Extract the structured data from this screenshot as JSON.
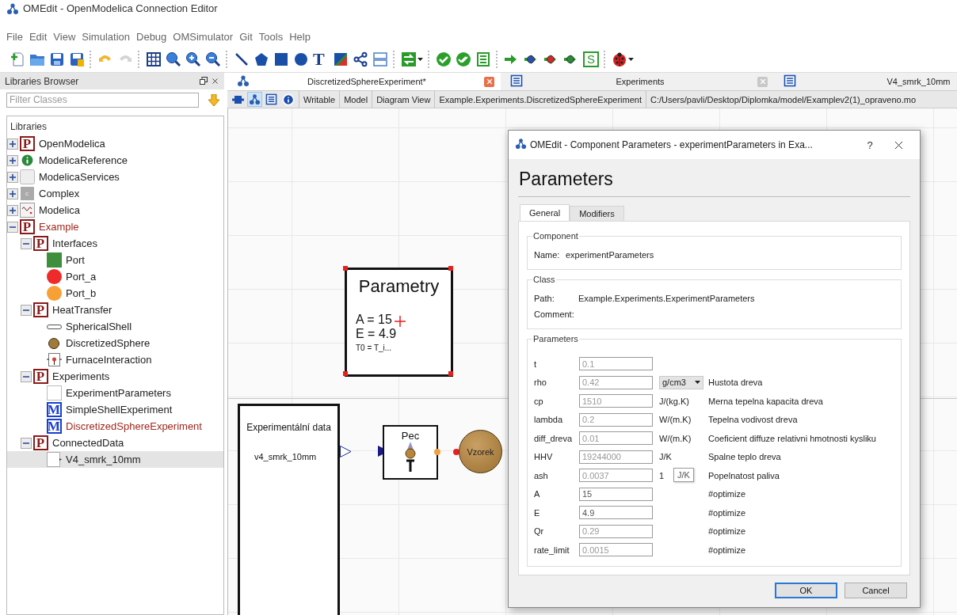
{
  "window": {
    "title": "OMEdit - OpenModelica Connection Editor"
  },
  "menu": [
    "File",
    "Edit",
    "View",
    "Simulation",
    "Debug",
    "OMSimulator",
    "Git",
    "Tools",
    "Help"
  ],
  "toolbar": [
    [
      {
        "kind": "new"
      },
      {
        "kind": "open"
      },
      {
        "kind": "save"
      },
      {
        "kind": "save-all"
      }
    ],
    [
      {
        "kind": "undo"
      },
      {
        "kind": "redo"
      }
    ],
    [
      {
        "kind": "grid"
      },
      {
        "kind": "zoom-reset"
      },
      {
        "kind": "zoom-in"
      },
      {
        "kind": "zoom-out"
      }
    ],
    [
      {
        "kind": "line"
      },
      {
        "kind": "polygon"
      },
      {
        "kind": "rectangle"
      },
      {
        "kind": "ellipse"
      },
      {
        "kind": "text-tool",
        "glyph": "T"
      },
      {
        "kind": "bitmap"
      },
      {
        "kind": "connect"
      },
      {
        "kind": "transition"
      }
    ],
    [
      {
        "kind": "swap"
      }
    ],
    [
      {
        "kind": "check"
      },
      {
        "kind": "check-all"
      },
      {
        "kind": "instantiate"
      }
    ],
    [
      {
        "kind": "simulate"
      },
      {
        "kind": "simulate-blue"
      },
      {
        "kind": "simulate-red"
      },
      {
        "kind": "simulate-green"
      },
      {
        "kind": "sim-setup",
        "glyph": "S"
      }
    ],
    [
      {
        "kind": "debugger"
      }
    ]
  ],
  "sidebar": {
    "title": "Libraries Browser",
    "filter": {
      "placeholder": "Filter Classes"
    },
    "root": "Libraries",
    "items": [
      {
        "label": "OpenModelica",
        "kind": "package",
        "badge": "P",
        "expanded": false,
        "modified": false,
        "selected": false
      },
      {
        "label": "ModelicaReference",
        "kind": "info",
        "expanded": false,
        "modified": false,
        "selected": false
      },
      {
        "label": "ModelicaServices",
        "kind": "blank",
        "expanded": false,
        "modified": false,
        "selected": false
      },
      {
        "label": "Complex",
        "kind": "complex",
        "badge": "c",
        "expanded": false,
        "modified": false,
        "selected": false
      },
      {
        "label": "Modelica",
        "kind": "modelica",
        "expanded": false,
        "modified": false,
        "selected": false
      },
      {
        "label": "Example",
        "kind": "package",
        "badge": "P",
        "expanded": true,
        "modified": true,
        "selected": false,
        "children": [
          {
            "label": "Interfaces",
            "kind": "package",
            "badge": "P",
            "expanded": true,
            "modified": false,
            "selected": false,
            "children": [
              {
                "label": "Port",
                "kind": "port-square",
                "color": "#3d8f3d",
                "modified": false,
                "selected": false
              },
              {
                "label": "Port_a",
                "kind": "port-circle",
                "color": "#ee2a2a",
                "modified": false,
                "selected": false
              },
              {
                "label": "Port_b",
                "kind": "port-circle",
                "color": "#f7a035",
                "modified": false,
                "selected": false
              }
            ]
          },
          {
            "label": "HeatTransfer",
            "kind": "package",
            "badge": "P",
            "expanded": true,
            "modified": false,
            "selected": false,
            "children": [
              {
                "label": "SphericalShell",
                "kind": "shell",
                "modified": false,
                "selected": false
              },
              {
                "label": "DiscretizedSphere",
                "kind": "sphere",
                "modified": false,
                "selected": false
              },
              {
                "label": "FurnaceInteraction",
                "kind": "furnace",
                "modified": false,
                "selected": false
              }
            ]
          },
          {
            "label": "Experiments",
            "kind": "package",
            "badge": "P",
            "expanded": true,
            "modified": false,
            "selected": false,
            "children": [
              {
                "label": "ExperimentParameters",
                "kind": "record",
                "modified": false,
                "selected": false
              },
              {
                "label": "SimpleShellExperiment",
                "kind": "model",
                "badge": "M",
                "modified": false,
                "selected": false
              },
              {
                "label": "DiscretizedSphereExperiment",
                "kind": "model",
                "badge": "M",
                "modified": true,
                "selected": false
              }
            ]
          },
          {
            "label": "ConnectedData",
            "kind": "package",
            "badge": "P",
            "expanded": true,
            "modified": false,
            "selected": false,
            "children": [
              {
                "label": "V4_smrk_10mm",
                "kind": "connector",
                "modified": false,
                "selected": true
              }
            ]
          }
        ]
      }
    ]
  },
  "tabs": [
    {
      "label": "DiscretizedSphereExperiment*",
      "kind": "diagram",
      "selected": true,
      "closable": true
    },
    {
      "label": "Experiments",
      "kind": "text",
      "selected": false,
      "closable": true
    },
    {
      "label": "V4_smrk_10mm",
      "kind": "text",
      "selected": false,
      "closable": false
    }
  ],
  "infobar": {
    "view_buttons": [
      {
        "kind": "icon-view",
        "selected": false
      },
      {
        "kind": "diagram-view",
        "selected": true
      },
      {
        "kind": "text-view",
        "selected": false
      },
      {
        "kind": "documentation-view",
        "selected": false
      }
    ],
    "cells": [
      "Writable",
      "Model",
      "Diagram View",
      "Example.Experiments.DiscretizedSphereExperiment",
      "C:/Users/pavli/Desktop/Diplomka/model/Examplev2(1)_opraveno.mo"
    ]
  },
  "diagram": {
    "components": [
      {
        "kind": "parameter-block",
        "title": "Parametry",
        "values": [
          "A = 15",
          "E = 4.9"
        ],
        "note": "T0 = T_i...",
        "selected": true
      },
      {
        "kind": "data-source",
        "title": "Experimentální data",
        "file": "v4_smrk_10mm"
      },
      {
        "kind": "furnace",
        "title": "Pec"
      },
      {
        "kind": "sample",
        "title": "Vzorek"
      }
    ]
  },
  "dialog": {
    "title": "OMEdit - Component Parameters - experimentParameters in Exa...",
    "help": "?",
    "heading": "Parameters",
    "tabs": [
      {
        "label": "General",
        "selected": true
      },
      {
        "label": "Modifiers",
        "selected": false
      }
    ],
    "component": {
      "legend": "Component",
      "name_label": "Name:",
      "name": "experimentParameters"
    },
    "class": {
      "legend": "Class",
      "path_label": "Path:",
      "path": "Example.Experiments.ExperimentParameters",
      "comment_label": "Comment:"
    },
    "parameters": {
      "legend": "Parameters",
      "rows": [
        {
          "name": "t",
          "placeholder": "0.1"
        },
        {
          "name": "rho",
          "placeholder": "0.42",
          "unit": "g/cm3",
          "dropdown": true,
          "comment": "Hustota dreva"
        },
        {
          "name": "cp",
          "placeholder": "1510",
          "unit": "J/(kg.K)",
          "dropdown": false,
          "comment": "Merna tepelna kapacita dreva"
        },
        {
          "name": "lambda",
          "placeholder": "0.2",
          "unit": "W/(m.K)",
          "dropdown": false,
          "comment": "Tepelna vodivost dreva"
        },
        {
          "name": "diff_dreva",
          "placeholder": "0.01",
          "unit": "W/(m.K)",
          "dropdown": false,
          "comment": "Coeficient diffuze relativni hmotnosti kysliku"
        },
        {
          "name": "HHV",
          "placeholder": "19244000",
          "unit": "J/K",
          "dropdown": false,
          "comment": "Spalne teplo dreva"
        },
        {
          "name": "ash",
          "placeholder": "0.0037",
          "unit": "1",
          "dropdown": false,
          "comment": "Popelnatost paliva"
        },
        {
          "name": "A",
          "value": "15",
          "comment": "#optimize"
        },
        {
          "name": "E",
          "value": "4.9",
          "comment": "#optimize"
        },
        {
          "name": "Qr",
          "placeholder": "0.29",
          "comment": "#optimize"
        },
        {
          "name": "rate_limit",
          "placeholder": "0.0015",
          "comment": "#optimize"
        }
      ]
    },
    "tooltip": "J/K",
    "buttons": [
      {
        "label": "OK",
        "default": true
      },
      {
        "label": "Cancel",
        "default": false
      }
    ]
  }
}
